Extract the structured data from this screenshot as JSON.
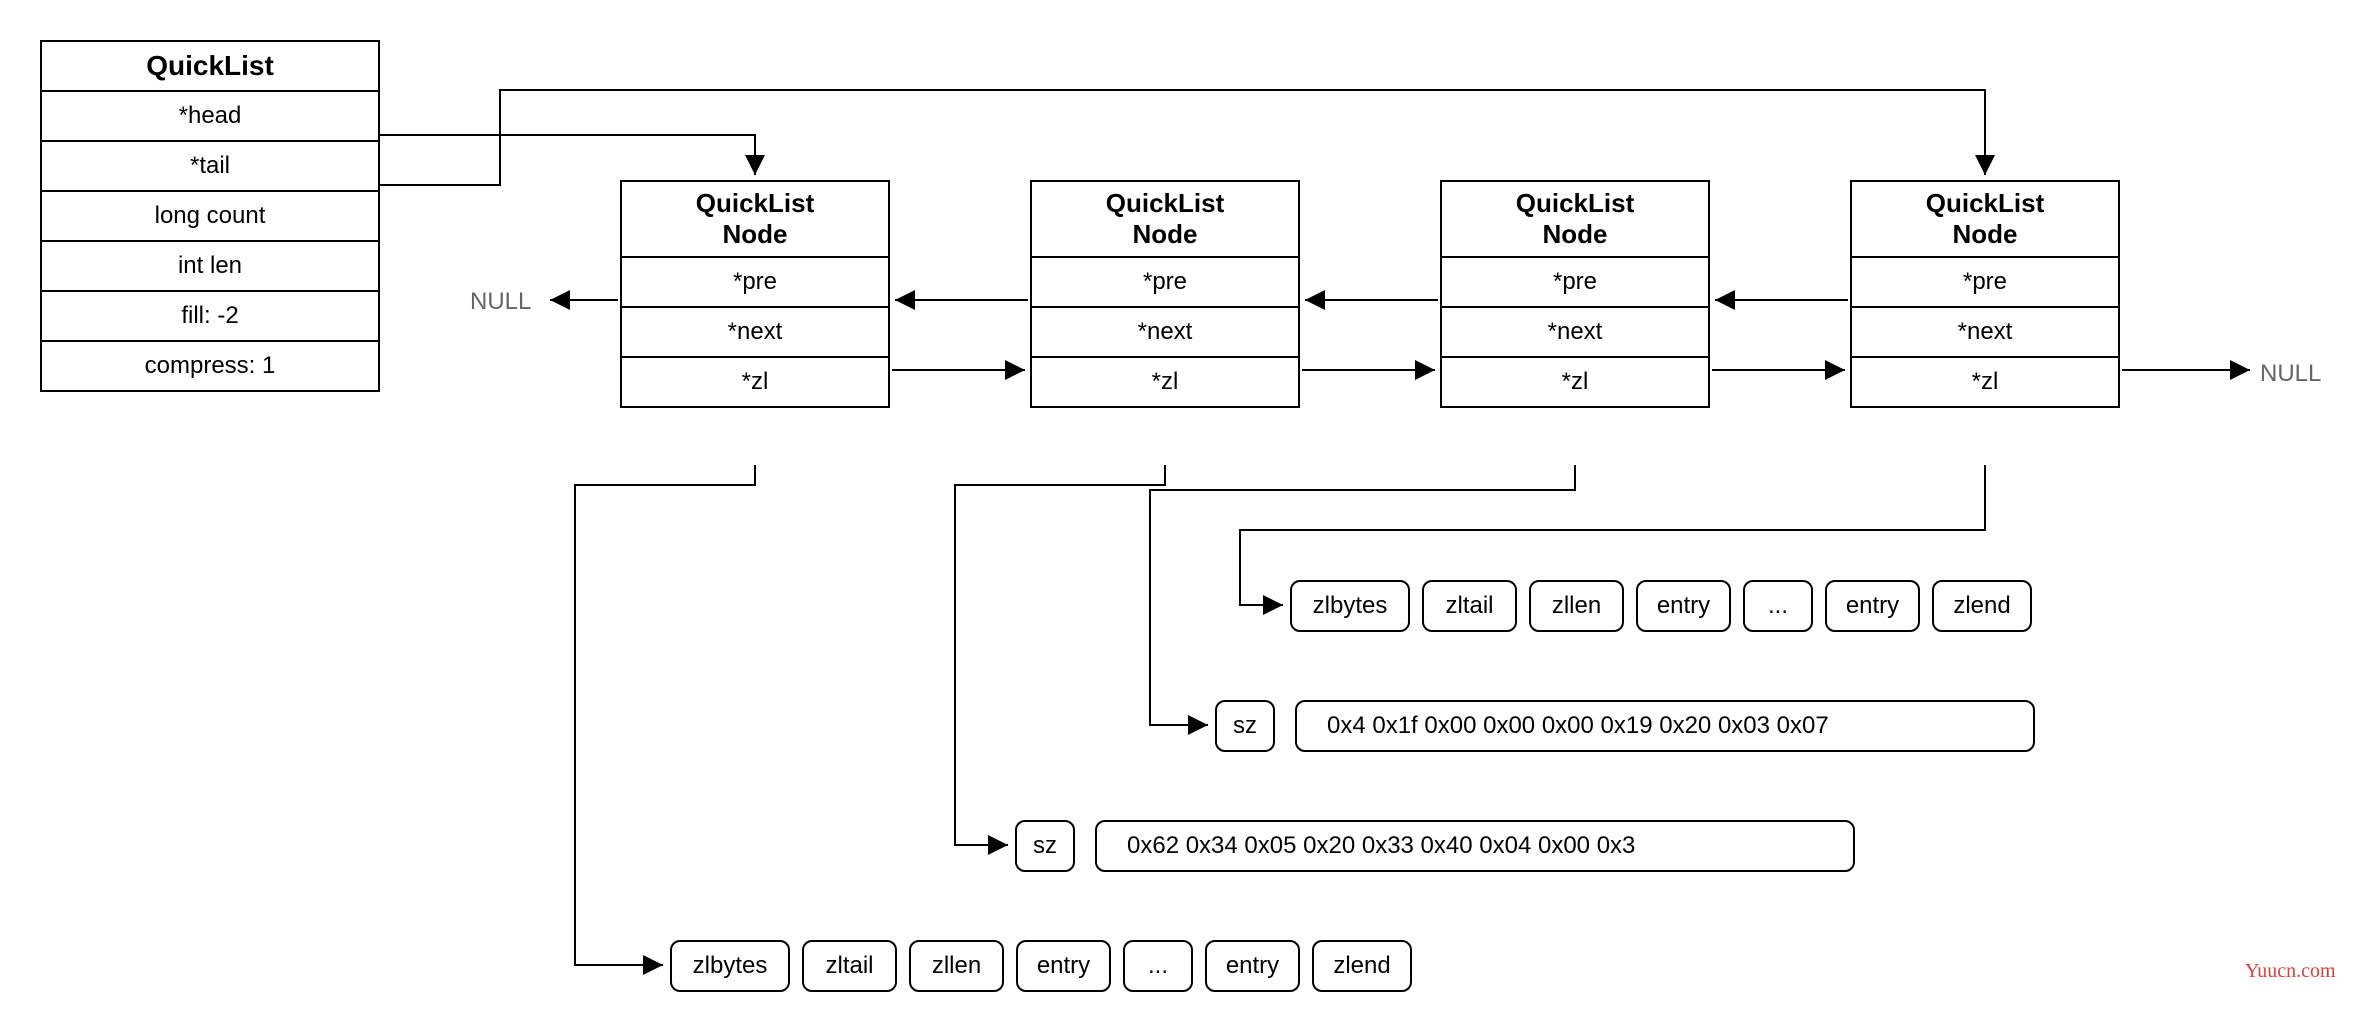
{
  "quicklist": {
    "title": "QuickList",
    "rows": [
      "*head",
      "*tail",
      "long count",
      "int len",
      "fill: -2",
      "compress: 1"
    ]
  },
  "nodes": {
    "title_line1": "QuickList",
    "title_line2": "Node",
    "rows": [
      "*pre",
      "*next",
      "*zl"
    ]
  },
  "null_label": "NULL",
  "ziplist_a": {
    "items": [
      "zlbytes",
      "zltail",
      "zllen",
      "entry",
      "...",
      "entry",
      "zlend"
    ]
  },
  "ziplist_b": {
    "items": [
      "zlbytes",
      "zltail",
      "zllen",
      "entry",
      "...",
      "entry",
      "zlend"
    ]
  },
  "compressed_a": {
    "sz": "sz",
    "hex": "0x4 0x1f 0x00 0x00 0x00 0x19 0x20 0x03 0x07"
  },
  "compressed_b": {
    "sz": "sz",
    "hex": "0x62 0x34 0x05 0x20 0x33 0x40 0x04 0x00 0x3"
  },
  "watermark": "Yuucn.com"
}
